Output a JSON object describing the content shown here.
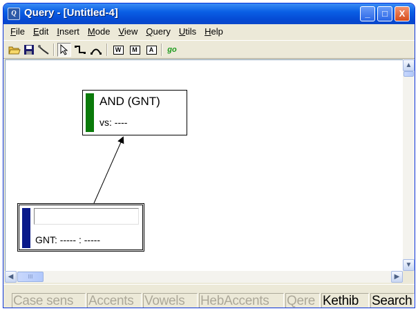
{
  "window": {
    "title": "Query - [Untitled-4]",
    "icon": "app-icon",
    "controls": {
      "minimize": "_",
      "maximize": "□",
      "close": "X"
    }
  },
  "menu": [
    {
      "label": "File",
      "accel": "F",
      "rest": "ile"
    },
    {
      "label": "Edit",
      "accel": "E",
      "rest": "dit"
    },
    {
      "label": "Insert",
      "accel": "I",
      "rest": "nsert"
    },
    {
      "label": "Mode",
      "accel": "M",
      "rest": "ode"
    },
    {
      "label": "View",
      "accel": "V",
      "rest": "iew"
    },
    {
      "label": "Query",
      "accel": "Q",
      "rest": "uery"
    },
    {
      "label": "Utils",
      "accel": "U",
      "rest": "tils"
    },
    {
      "label": "Help",
      "accel": "H",
      "rest": "elp"
    }
  ],
  "toolbar": {
    "open_icon": "open-folder-icon",
    "save_icon": "save-disk-icon",
    "link_icon": "link-tool-icon",
    "select_icon": "arrow-pointer-icon",
    "connect_icon": "connector-icon",
    "arc_icon": "arc-icon",
    "box_w": "W",
    "box_m": "M",
    "box_a": "A",
    "go_label": "go"
  },
  "nodes": {
    "and_node": {
      "title": "AND (GNT)",
      "sub": "vs: ----",
      "bar_color": "#0a7a0a"
    },
    "word_node": {
      "input_value": "",
      "sub": "GNT: ----- : -----",
      "bar_color": "#0a1a8a"
    }
  },
  "scrollbars": {
    "up": "▲",
    "down": "▼",
    "left": "◀",
    "right": "▶",
    "grip": "III"
  },
  "status": [
    {
      "label": "Case sens",
      "enabled": false
    },
    {
      "label": "Accents",
      "enabled": false
    },
    {
      "label": "Vowels",
      "enabled": false
    },
    {
      "label": "HebAccents",
      "enabled": false
    },
    {
      "label": "Qere",
      "enabled": false
    },
    {
      "label": "Kethib",
      "enabled": true
    },
    {
      "label": "Search",
      "enabled": true
    }
  ],
  "colors": {
    "titlebar": "#0a5fe5",
    "and_bar": "#0a7a0a",
    "word_bar": "#0a1a8a"
  }
}
